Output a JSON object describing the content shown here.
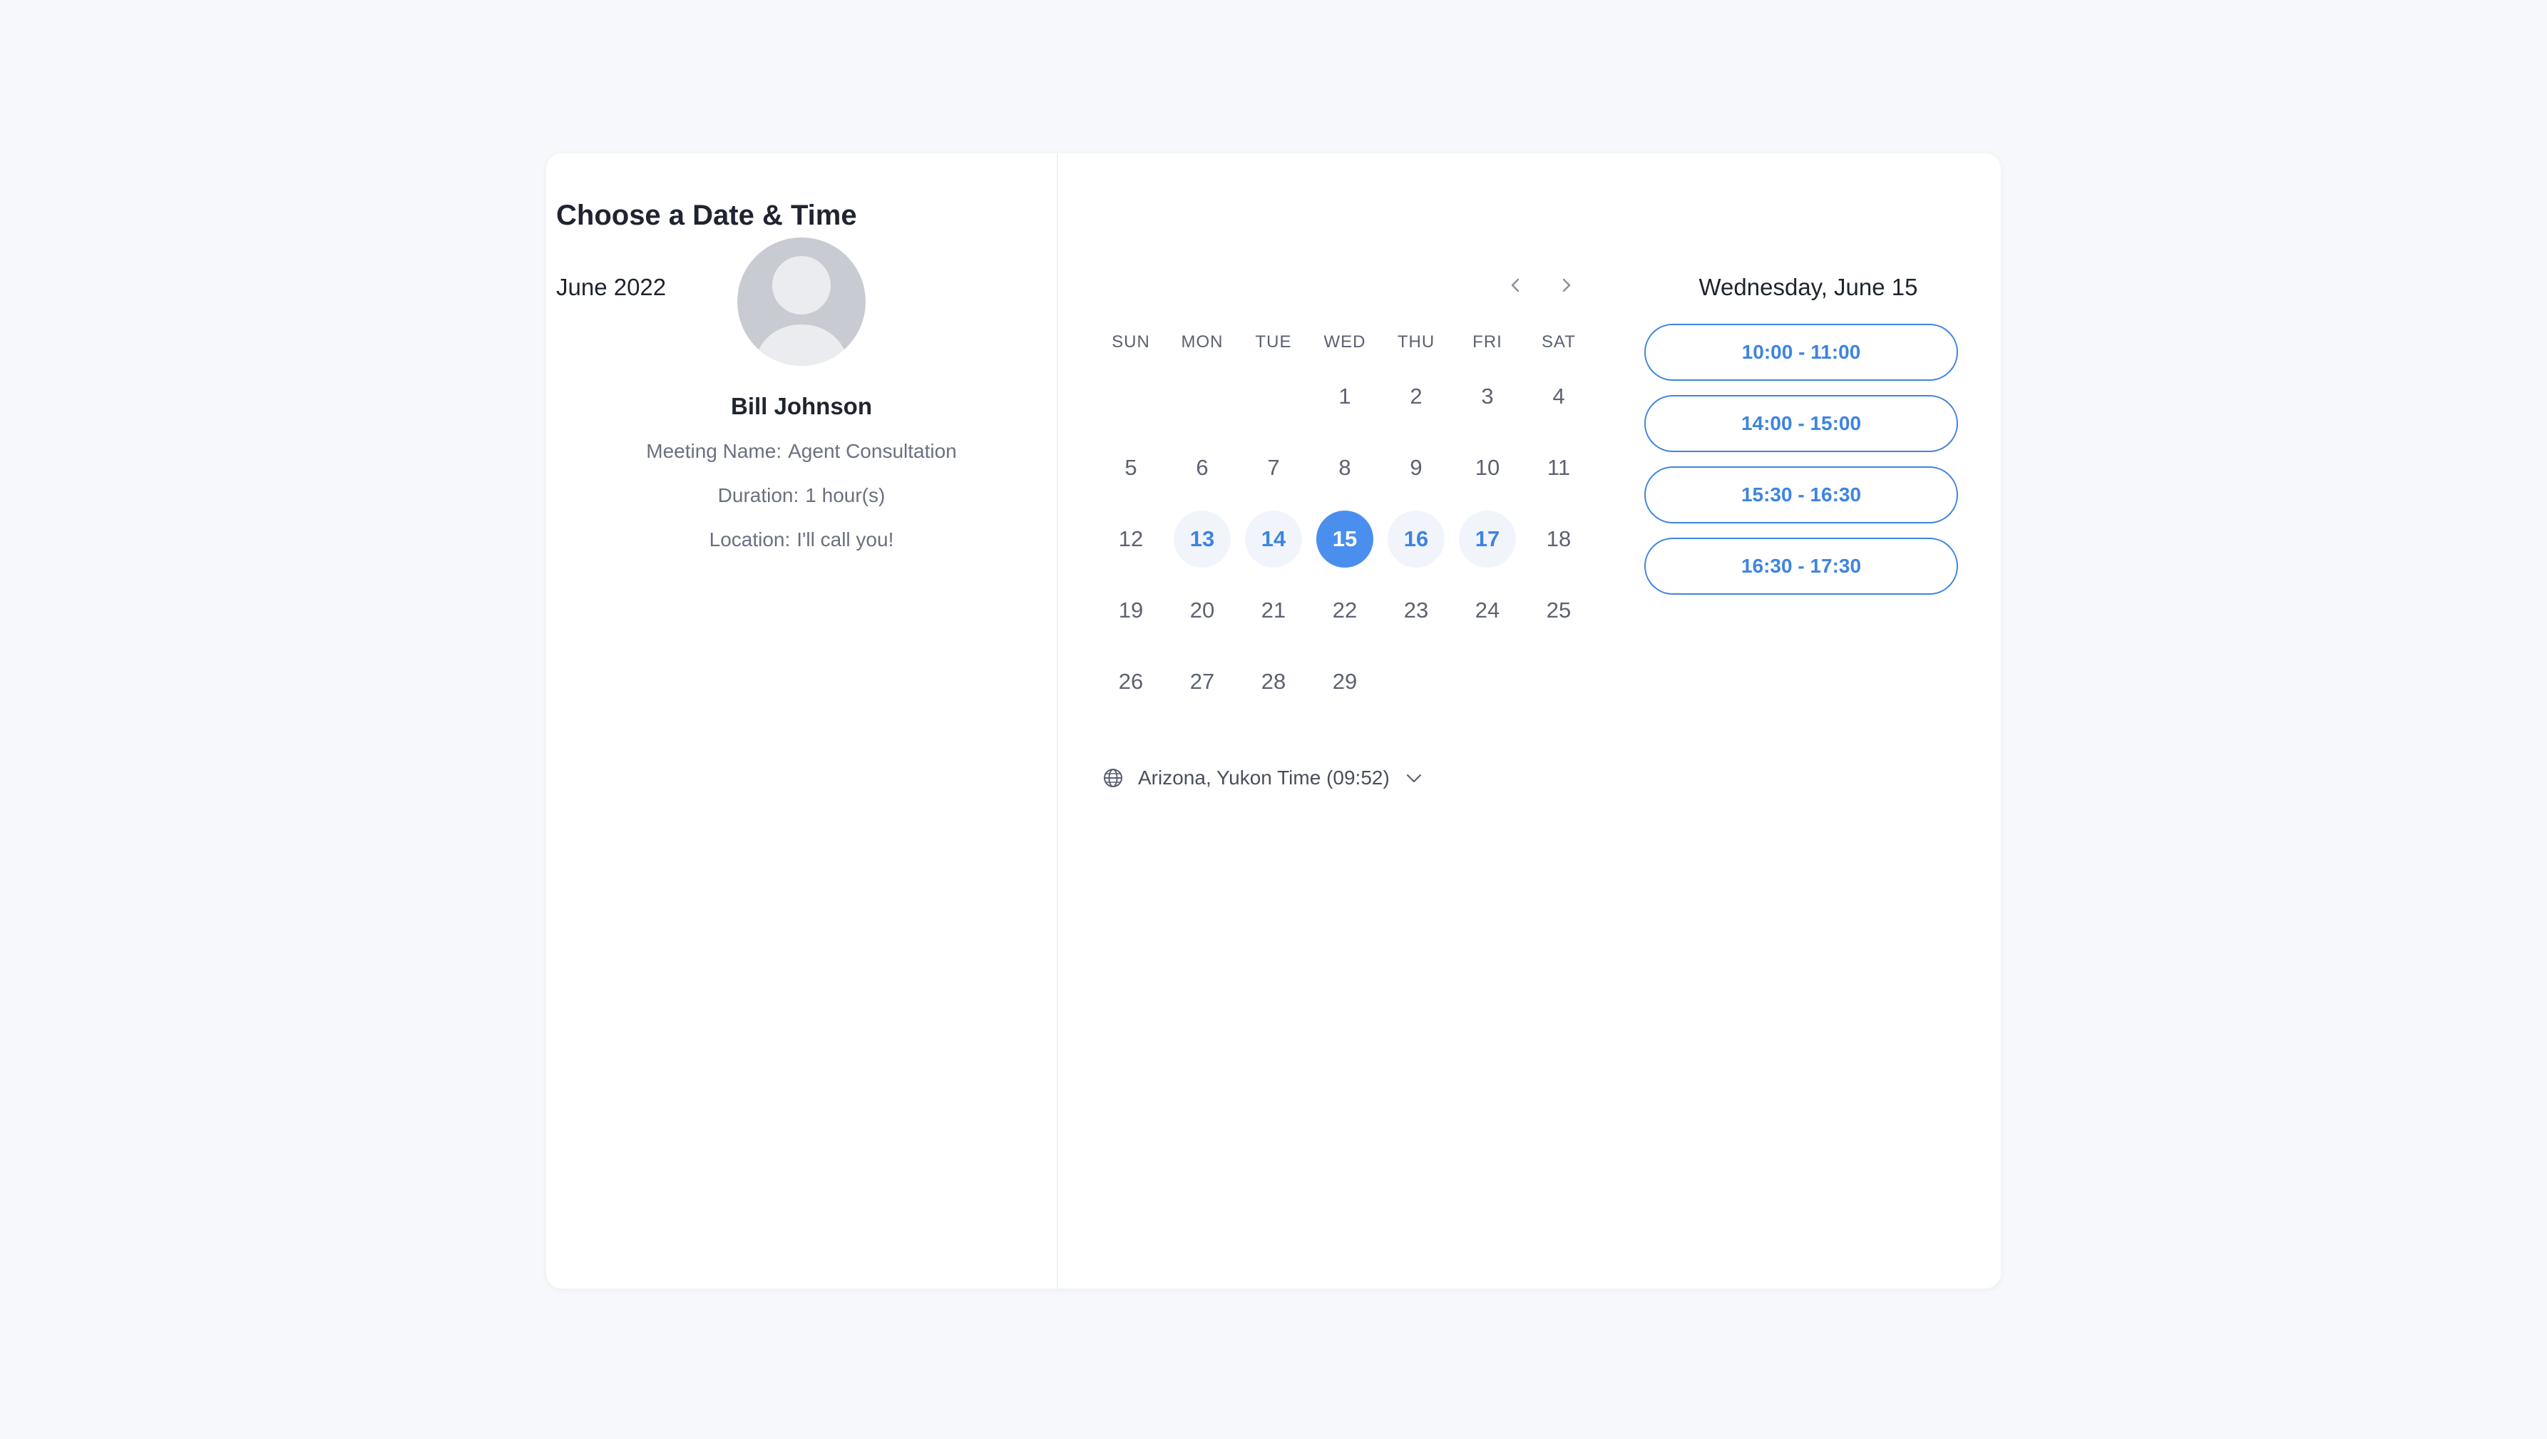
{
  "host": {
    "name": "Bill Johnson",
    "meeting_label": "Meeting Name:",
    "meeting_value": "Agent Consultation",
    "duration_label": "Duration:",
    "duration_value": "1 hour(s)",
    "location_label": "Location:",
    "location_value": "I'll call you!"
  },
  "scheduler": {
    "title": "Choose a Date & Time",
    "month": "June 2022",
    "weekdays": [
      "SUN",
      "MON",
      "TUE",
      "WED",
      "THU",
      "FRI",
      "SAT"
    ],
    "days": [
      "1",
      "2",
      "3",
      "4",
      "5",
      "6",
      "7",
      "8",
      "9",
      "10",
      "11",
      "12",
      "13",
      "14",
      "15",
      "16",
      "17",
      "18",
      "19",
      "20",
      "21",
      "22",
      "23",
      "24",
      "25",
      "26",
      "27",
      "28",
      "29"
    ],
    "timezone": "Arizona, Yukon Time (09:52)"
  },
  "slots": {
    "date_label": "Wednesday, June 15",
    "times": [
      "10:00 - 11:00",
      "14:00 - 15:00",
      "15:30 - 16:30",
      "16:30 - 17:30"
    ]
  },
  "colors": {
    "accent": "#3e84e0",
    "selected_fill": "#4a8fee",
    "available_fill": "#f1f5fb"
  },
  "icons": {
    "prev": "chevron-left-icon",
    "next": "chevron-right-icon",
    "timezone": "globe-icon",
    "timezone_toggle": "chevron-down-icon"
  }
}
